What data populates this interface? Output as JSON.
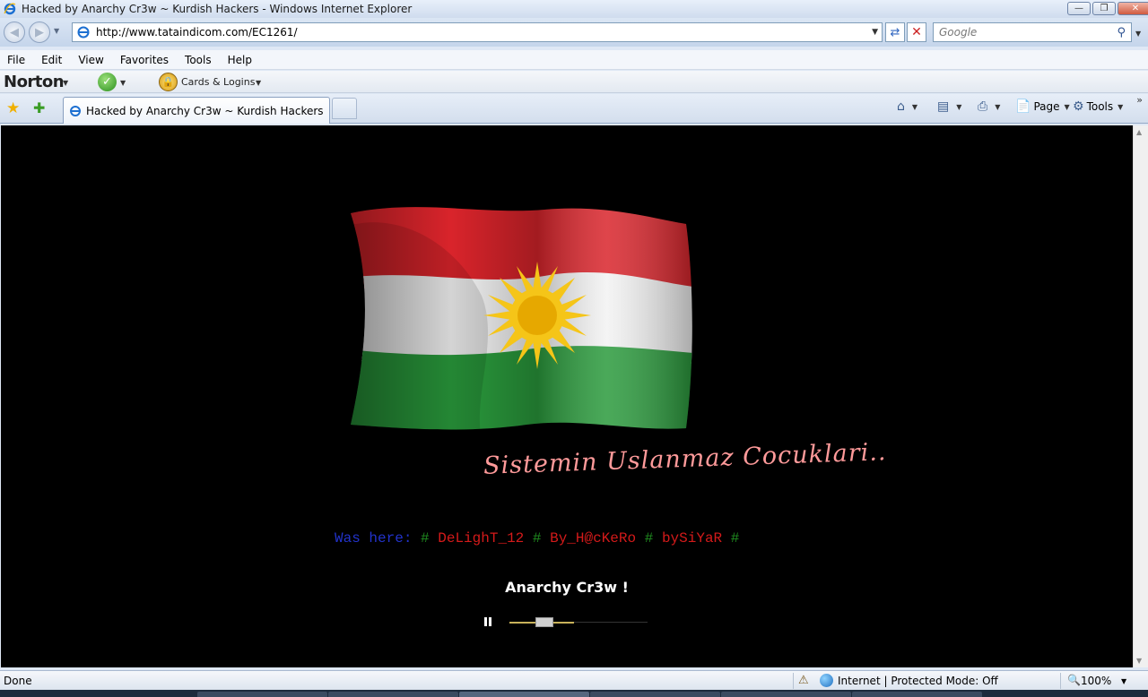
{
  "window": {
    "title": "Hacked by Anarchy Cr3w ~ Kurdish Hackers - Windows Internet Explorer",
    "controls": [
      "minimize",
      "maximize",
      "close"
    ]
  },
  "address_bar": {
    "url": "http://www.tataindicom.com/EC1261/"
  },
  "search": {
    "placeholder": "Google"
  },
  "menu": {
    "items": [
      "File",
      "Edit",
      "View",
      "Favorites",
      "Tools",
      "Help"
    ]
  },
  "norton_toolbar": {
    "brand": "Norton",
    "cards_label": "Cards & Logins"
  },
  "tabs": [
    {
      "label": "Hacked by Anarchy Cr3w ~ Kurdish Hackers",
      "active": true
    }
  ],
  "command_bar": {
    "page_label": "Page",
    "tools_label": "Tools"
  },
  "page": {
    "background": "#000000",
    "slogan": "Sistemin Uslanmaz Cocuklari..",
    "was_here": {
      "prefix": "Was here:",
      "separator": "#",
      "names": [
        "DeLighT_12",
        "By_H@cKeRo",
        "bySiYaR"
      ]
    },
    "crew_title": "Anarchy Cr3w !",
    "player": {
      "state": "playing",
      "progress_fraction": 0.47,
      "buffered_fraction": 0.47
    }
  },
  "status_bar": {
    "status": "Done",
    "zone": "Internet | Protected Mode: Off",
    "zoom": "100%"
  },
  "colors": {
    "accent_blue": "#2233cc",
    "accent_green": "#1f8a1f",
    "accent_red": "#d41a1a",
    "slogan_pink": "#ff9a9a"
  }
}
